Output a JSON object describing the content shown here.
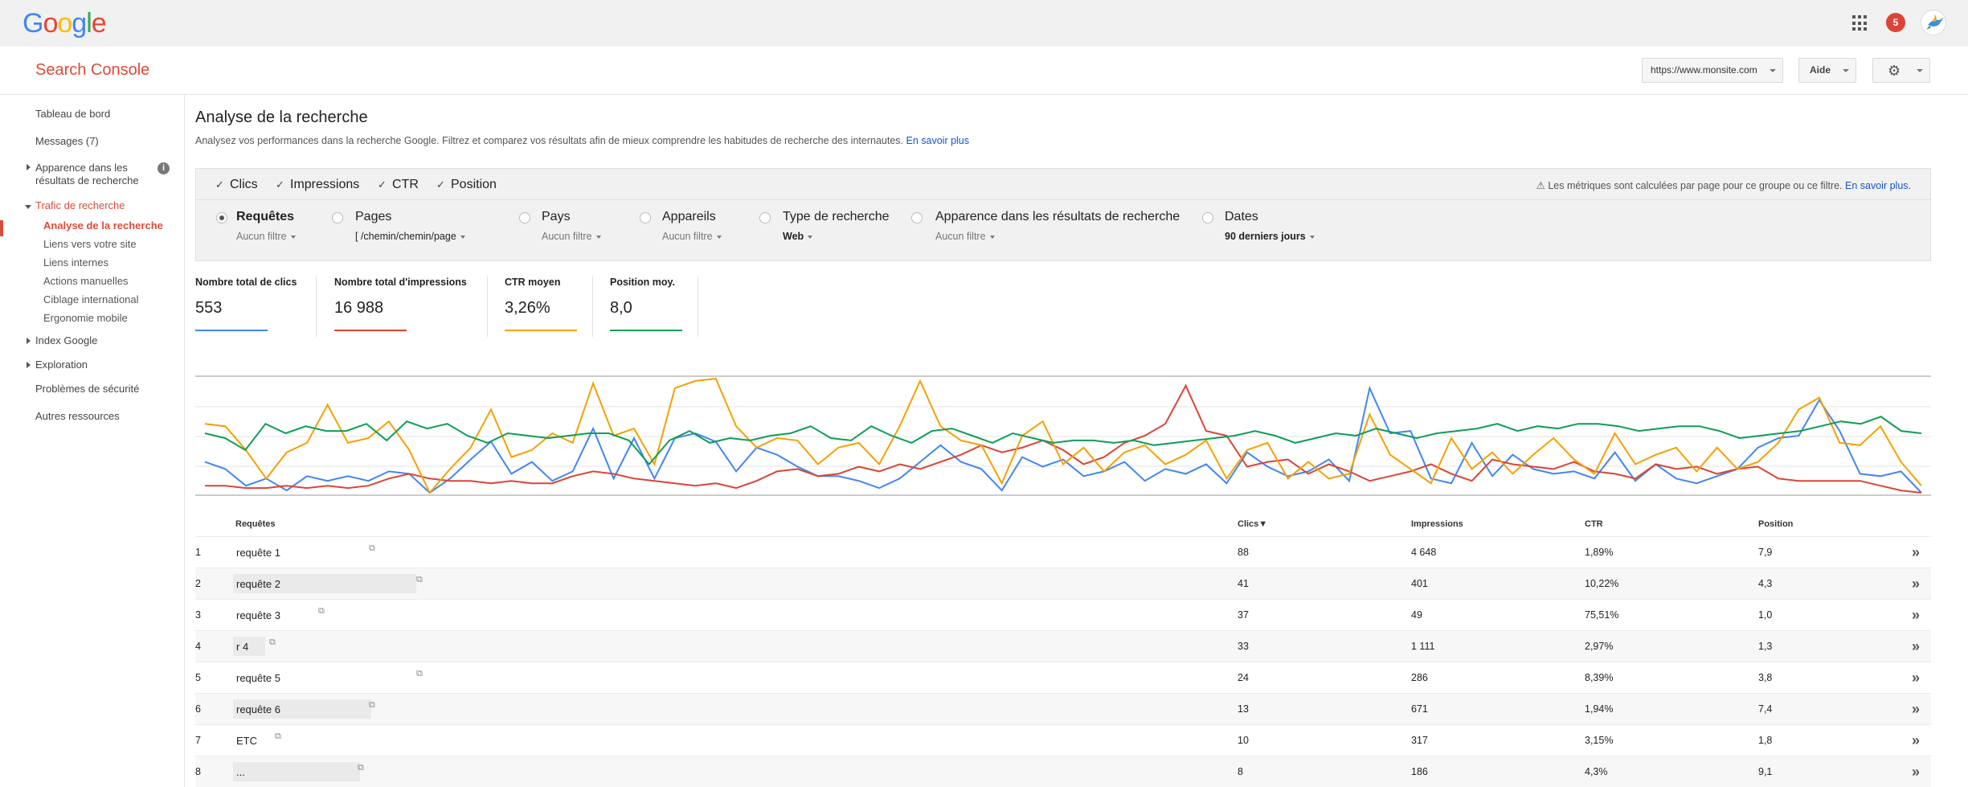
{
  "header": {
    "logo": [
      "G",
      "o",
      "o",
      "g",
      "l",
      "e"
    ],
    "logo_colors": [
      "#4285f4",
      "#ea4335",
      "#fbbc05",
      "#4285f4",
      "#34a853",
      "#ea4335"
    ],
    "notif_count": "5",
    "product": "Search Console",
    "site": "https://www.monsite.com",
    "help": "Aide"
  },
  "sidebar": {
    "items": [
      {
        "label": "Tableau de bord"
      },
      {
        "label": "Messages (7)"
      },
      {
        "label": "Apparence dans les résultats de recherche"
      },
      {
        "label": "Trafic de recherche"
      },
      {
        "label": "Analyse de la recherche"
      },
      {
        "label": "Liens vers votre site"
      },
      {
        "label": "Liens internes"
      },
      {
        "label": "Actions manuelles"
      },
      {
        "label": "Ciblage international"
      },
      {
        "label": "Ergonomie mobile"
      },
      {
        "label": "Index Google"
      },
      {
        "label": "Exploration"
      },
      {
        "label": "Problèmes de sécurité"
      },
      {
        "label": "Autres ressources"
      }
    ]
  },
  "main": {
    "title": "Analyse de la recherche",
    "description": "Analysez vos performances dans la recherche Google. Filtrez et comparez vos résultats afin de mieux comprendre les habitudes de recherche des internautes.",
    "learn_more": "En savoir plus",
    "metrics": [
      "Clics",
      "Impressions",
      "CTR",
      "Position"
    ],
    "metrics_note": "Les métriques sont calculées par page pour ce groupe ou ce filtre.",
    "metrics_note_link": "En savoir plus.",
    "filters": [
      {
        "label": "Requêtes",
        "sub": "Aucun filtre"
      },
      {
        "label": "Pages",
        "sub": "/chemin/chemin/page"
      },
      {
        "label": "Pays",
        "sub": "Aucun filtre"
      },
      {
        "label": "Appareils",
        "sub": "Aucun filtre"
      },
      {
        "label": "Type de recherche",
        "sub": "Web"
      },
      {
        "label": "Apparence dans les résultats de recherche",
        "sub": "Aucun filtre"
      },
      {
        "label": "Dates",
        "sub": "90 derniers jours"
      }
    ],
    "totals": [
      {
        "label": "Nombre total de clics",
        "value": "553",
        "color": "#4285f4"
      },
      {
        "label": "Nombre total d'impressions",
        "value": "16 988",
        "color": "#db4437"
      },
      {
        "label": "CTR moyen",
        "value": "3,26%",
        "color": "#f4a100"
      },
      {
        "label": "Position moy.",
        "value": "8,0",
        "color": "#0f9d58"
      }
    ]
  },
  "table": {
    "headers": {
      "query": "Requêtes",
      "clicks": "Clics▼",
      "impressions": "Impressions",
      "ctr": "CTR",
      "position": "Position"
    },
    "rows": [
      {
        "n": "1",
        "query": "requête 1",
        "clicks": "88",
        "impressions": "4 648",
        "ctr": "1,89%",
        "position": "7,9"
      },
      {
        "n": "2",
        "query": "requête 2",
        "clicks": "41",
        "impressions": "401",
        "ctr": "10,22%",
        "position": "4,3"
      },
      {
        "n": "3",
        "query": "requête 3",
        "clicks": "37",
        "impressions": "49",
        "ctr": "75,51%",
        "position": "1,0"
      },
      {
        "n": "4",
        "query": "r 4",
        "clicks": "33",
        "impressions": "1 111",
        "ctr": "2,97%",
        "position": "1,3"
      },
      {
        "n": "5",
        "query": "requête 5",
        "clicks": "24",
        "impressions": "286",
        "ctr": "8,39%",
        "position": "3,8"
      },
      {
        "n": "6",
        "query": "requête 6",
        "clicks": "13",
        "impressions": "671",
        "ctr": "1,94%",
        "position": "7,4"
      },
      {
        "n": "7",
        "query": "ETC",
        "clicks": "10",
        "impressions": "317",
        "ctr": "3,15%",
        "position": "1,8"
      },
      {
        "n": "8",
        "query": "...",
        "clicks": "8",
        "impressions": "186",
        "ctr": "4,3%",
        "position": "9,1"
      }
    ]
  },
  "chart_data": {
    "type": "line",
    "grid": true,
    "ylim": [
      0,
      1
    ],
    "series": [
      {
        "color": "#4285f4",
        "values": [
          0.28,
          0.22,
          0.08,
          0.14,
          0.04,
          0.16,
          0.12,
          0.16,
          0.12,
          0.2,
          0.18,
          0.02,
          0.14,
          0.3,
          0.45,
          0.18,
          0.28,
          0.12,
          0.2,
          0.56,
          0.14,
          0.48,
          0.14,
          0.48,
          0.52,
          0.45,
          0.2,
          0.4,
          0.34,
          0.24,
          0.16,
          0.16,
          0.12,
          0.06,
          0.14,
          0.28,
          0.42,
          0.28,
          0.22,
          0.04,
          0.32,
          0.24,
          0.3,
          0.16,
          0.2,
          0.28,
          0.12,
          0.22,
          0.18,
          0.26,
          0.1,
          0.36,
          0.24,
          0.16,
          0.2,
          0.3,
          0.12,
          0.9,
          0.52,
          0.54,
          0.14,
          0.1,
          0.44,
          0.16,
          0.34,
          0.22,
          0.18,
          0.2,
          0.14,
          0.36,
          0.12,
          0.26,
          0.14,
          0.1,
          0.16,
          0.22,
          0.4,
          0.48,
          0.5,
          0.8,
          0.54,
          0.18,
          0.16,
          0.2,
          0.02
        ]
      },
      {
        "color": "#db4437",
        "values": [
          0.08,
          0.08,
          0.06,
          0.06,
          0.08,
          0.06,
          0.08,
          0.06,
          0.08,
          0.14,
          0.18,
          0.14,
          0.12,
          0.12,
          0.1,
          0.12,
          0.1,
          0.1,
          0.16,
          0.2,
          0.18,
          0.14,
          0.12,
          0.1,
          0.08,
          0.1,
          0.06,
          0.12,
          0.2,
          0.22,
          0.16,
          0.18,
          0.24,
          0.2,
          0.26,
          0.22,
          0.28,
          0.34,
          0.42,
          0.36,
          0.4,
          0.46,
          0.38,
          0.26,
          0.32,
          0.44,
          0.5,
          0.6,
          0.92,
          0.54,
          0.5,
          0.24,
          0.28,
          0.3,
          0.18,
          0.26,
          0.2,
          0.12,
          0.16,
          0.2,
          0.26,
          0.18,
          0.12,
          0.3,
          0.26,
          0.24,
          0.22,
          0.28,
          0.2,
          0.18,
          0.14,
          0.26,
          0.22,
          0.24,
          0.18,
          0.22,
          0.24,
          0.14,
          0.12,
          0.12,
          0.12,
          0.12,
          0.08,
          0.04,
          0.02
        ]
      },
      {
        "color": "#f4a100",
        "values": [
          0.6,
          0.58,
          0.38,
          0.14,
          0.36,
          0.44,
          0.76,
          0.44,
          0.48,
          0.62,
          0.38,
          0.02,
          0.22,
          0.4,
          0.72,
          0.32,
          0.38,
          0.52,
          0.44,
          0.94,
          0.5,
          0.56,
          0.26,
          0.9,
          0.96,
          0.98,
          0.58,
          0.4,
          0.48,
          0.46,
          0.26,
          0.4,
          0.44,
          0.26,
          0.58,
          0.96,
          0.58,
          0.46,
          0.42,
          0.1,
          0.5,
          0.62,
          0.26,
          0.4,
          0.2,
          0.36,
          0.42,
          0.26,
          0.34,
          0.46,
          0.14,
          0.38,
          0.44,
          0.14,
          0.28,
          0.14,
          0.18,
          0.68,
          0.34,
          0.22,
          0.1,
          0.48,
          0.22,
          0.36,
          0.18,
          0.34,
          0.48,
          0.3,
          0.18,
          0.52,
          0.26,
          0.34,
          0.4,
          0.2,
          0.4,
          0.22,
          0.28,
          0.44,
          0.72,
          0.82,
          0.44,
          0.42,
          0.58,
          0.28,
          0.08
        ]
      },
      {
        "color": "#0f9d58",
        "values": [
          0.52,
          0.48,
          0.38,
          0.6,
          0.52,
          0.58,
          0.54,
          0.54,
          0.6,
          0.46,
          0.62,
          0.56,
          0.6,
          0.5,
          0.44,
          0.52,
          0.5,
          0.48,
          0.5,
          0.52,
          0.52,
          0.46,
          0.26,
          0.46,
          0.54,
          0.44,
          0.48,
          0.46,
          0.5,
          0.52,
          0.58,
          0.48,
          0.46,
          0.58,
          0.5,
          0.44,
          0.54,
          0.56,
          0.5,
          0.44,
          0.52,
          0.48,
          0.44,
          0.46,
          0.46,
          0.44,
          0.46,
          0.42,
          0.44,
          0.46,
          0.48,
          0.5,
          0.54,
          0.5,
          0.44,
          0.48,
          0.52,
          0.5,
          0.56,
          0.52,
          0.48,
          0.52,
          0.54,
          0.56,
          0.6,
          0.54,
          0.58,
          0.56,
          0.6,
          0.6,
          0.58,
          0.54,
          0.56,
          0.58,
          0.58,
          0.54,
          0.48,
          0.5,
          0.52,
          0.54,
          0.58,
          0.62,
          0.6,
          0.66,
          0.54,
          0.52
        ]
      }
    ]
  }
}
